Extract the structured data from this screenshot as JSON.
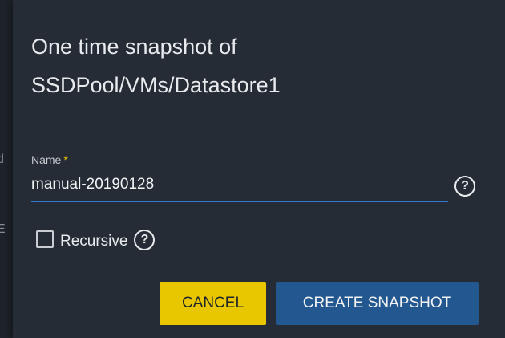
{
  "background": {
    "fragments": [
      "d",
      "E"
    ]
  },
  "dialog": {
    "title": "One time snapshot of SSDPool/VMs/Datastore1",
    "name_field": {
      "label": "Name",
      "required_marker": "*",
      "value": "manual-20190128"
    },
    "help_icon": "help-icon",
    "recursive_checkbox": {
      "label": "Recursive",
      "checked": false
    },
    "buttons": {
      "cancel_label": "CANCEL",
      "create_label": "CREATE SNAPSHOT"
    }
  },
  "colors": {
    "dialog_bg": "#252c35",
    "cancel_button": "#e8c600",
    "create_button": "#23578f",
    "input_underline": "#2f7bd1",
    "required_marker": "#e6c200"
  }
}
